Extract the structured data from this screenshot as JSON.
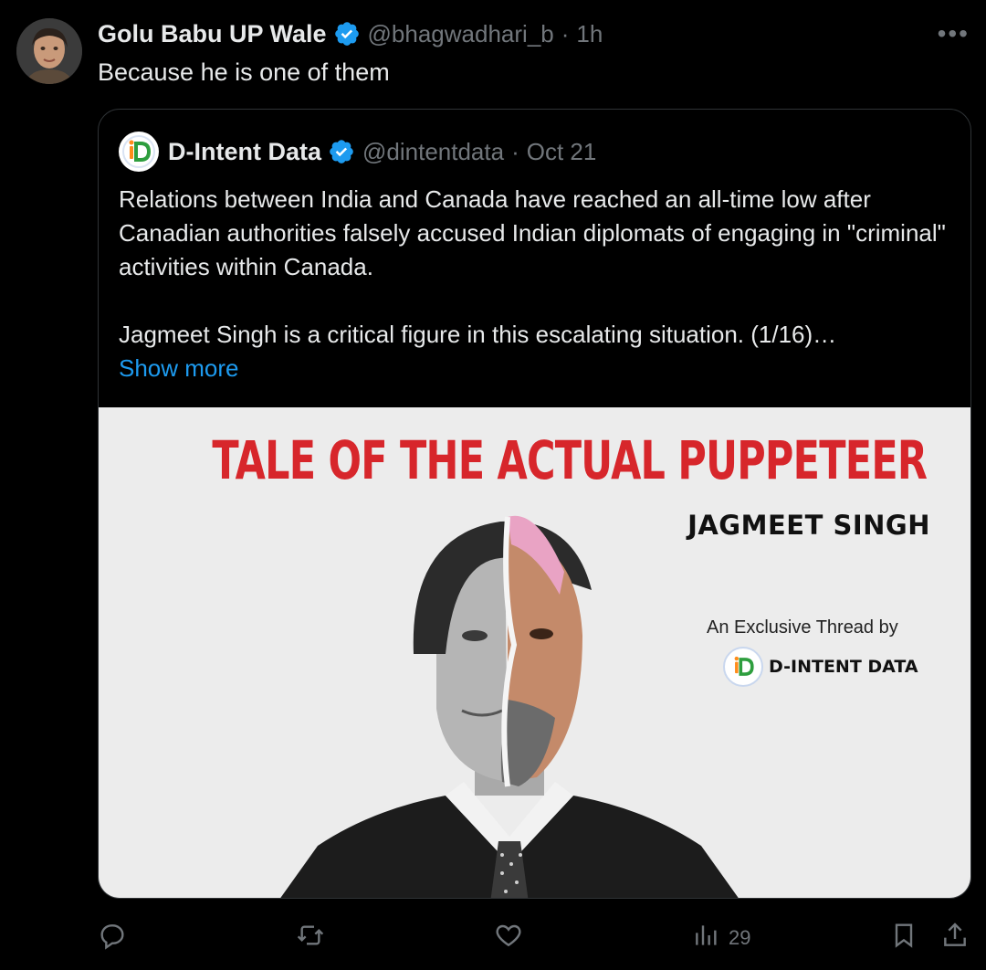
{
  "tweet": {
    "author_name": "Golu Babu UP Wale",
    "handle": "@bhagwadhari_b",
    "separator": "·",
    "time": "1h",
    "more_label": "•••",
    "text": "Because he is one of them"
  },
  "quote": {
    "author_name": "D-Intent Data",
    "handle": "@dintentdata",
    "separator": "·",
    "date": "Oct 21",
    "paragraph1": "Relations between India and Canada have reached an all-time low after Canadian authorities falsely accused Indian diplomats of engaging in \"criminal\" activities within Canada.",
    "paragraph2": "Jagmeet Singh is a critical figure in this escalating situation. (1/16)…",
    "show_more": "Show more",
    "media": {
      "title": "TALE OF THE ACTUAL PUPPETEER",
      "subtitle": "JAGMEET SINGH",
      "byline": "An Exclusive Thread by",
      "brand": "D-INTENT DATA"
    }
  },
  "actions": {
    "reply_icon": "reply-icon",
    "retweet_icon": "retweet-icon",
    "like_icon": "heart-icon",
    "views_icon": "views-icon",
    "views_count": "29",
    "bookmark_icon": "bookmark-icon",
    "share_icon": "share-icon"
  },
  "colors": {
    "background": "#000000",
    "text": "#e7e9ea",
    "muted": "#71767b",
    "link": "#1d9bf0",
    "verified": "#1d9bf0",
    "title_red": "#d7262b"
  }
}
